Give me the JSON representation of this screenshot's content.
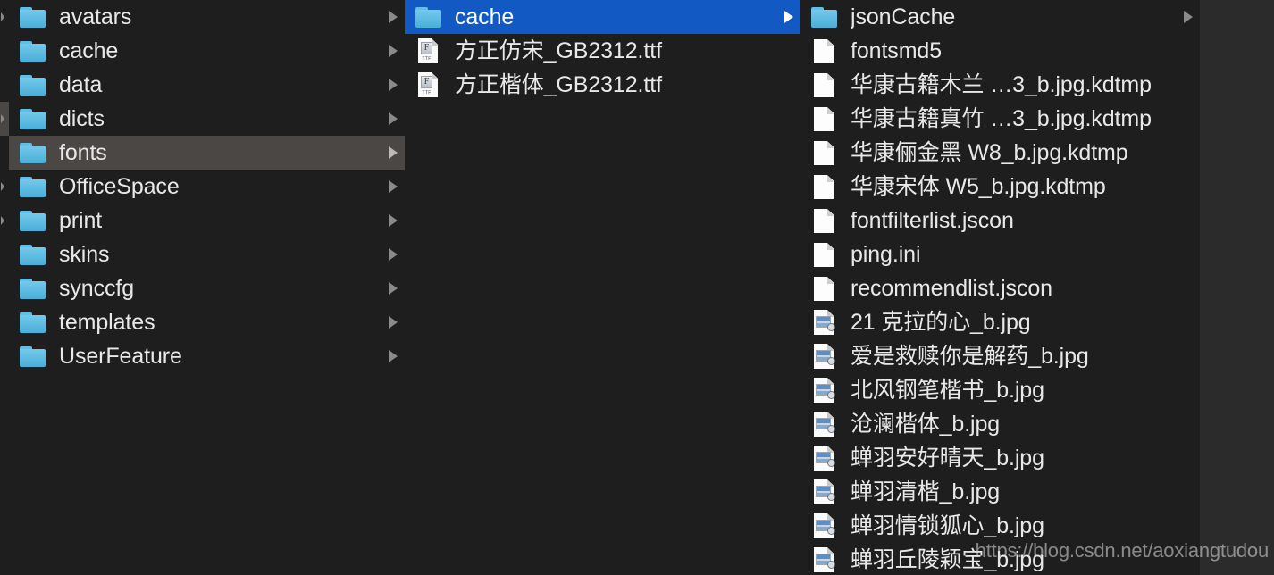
{
  "window": {
    "view_mode": "column-view",
    "background_color": "#2b2b2b",
    "column_background_color": "#1e1e1e",
    "selection_color": "#1259c4",
    "highlight_color": "#4a4745",
    "text_color": "#e8e8e8"
  },
  "partial_column": {
    "rows": [
      {
        "has_arrow": true,
        "highlighted": false
      },
      {
        "has_arrow": false,
        "highlighted": false
      },
      {
        "has_arrow": false,
        "highlighted": false
      },
      {
        "has_arrow": true,
        "highlighted": true
      },
      {
        "has_arrow": false,
        "highlighted": false
      },
      {
        "has_arrow": true,
        "highlighted": false
      },
      {
        "has_arrow": true,
        "highlighted": false
      },
      {
        "has_arrow": false,
        "highlighted": false
      },
      {
        "has_arrow": false,
        "highlighted": false
      },
      {
        "has_arrow": false,
        "highlighted": false
      },
      {
        "has_arrow": false,
        "highlighted": false
      },
      {
        "has_arrow": false,
        "highlighted": false
      },
      {
        "has_arrow": false,
        "highlighted": false
      },
      {
        "has_arrow": false,
        "highlighted": false
      },
      {
        "has_arrow": false,
        "highlighted": false
      },
      {
        "has_arrow": false,
        "highlighted": false
      },
      {
        "has_arrow": false,
        "highlighted": false
      }
    ]
  },
  "column_1": {
    "name": "parent-folder-column",
    "items": [
      {
        "label": "avatars",
        "icon": "folder-icon",
        "arrow": true,
        "state": "normal"
      },
      {
        "label": "cache",
        "icon": "folder-icon",
        "arrow": true,
        "state": "normal"
      },
      {
        "label": "data",
        "icon": "folder-icon",
        "arrow": true,
        "state": "normal"
      },
      {
        "label": "dicts",
        "icon": "folder-icon",
        "arrow": true,
        "state": "normal"
      },
      {
        "label": "fonts",
        "icon": "folder-icon",
        "arrow": true,
        "state": "highlighted"
      },
      {
        "label": "OfficeSpace",
        "icon": "folder-icon",
        "arrow": true,
        "state": "normal"
      },
      {
        "label": "print",
        "icon": "folder-icon",
        "arrow": true,
        "state": "normal"
      },
      {
        "label": "skins",
        "icon": "folder-icon",
        "arrow": true,
        "state": "normal"
      },
      {
        "label": "synccfg",
        "icon": "folder-icon",
        "arrow": true,
        "state": "normal"
      },
      {
        "label": "templates",
        "icon": "folder-icon",
        "arrow": true,
        "state": "normal"
      },
      {
        "label": "UserFeature",
        "icon": "folder-icon",
        "arrow": true,
        "state": "normal"
      }
    ]
  },
  "column_2": {
    "name": "fonts-folder-column",
    "items": [
      {
        "label": "cache",
        "icon": "folder-icon",
        "arrow": true,
        "state": "selected"
      },
      {
        "label": "方正仿宋_GB2312.ttf",
        "icon": "ttf-file-icon",
        "arrow": false,
        "state": "normal"
      },
      {
        "label": "方正楷体_GB2312.ttf",
        "icon": "ttf-file-icon",
        "arrow": false,
        "state": "normal"
      }
    ]
  },
  "column_3": {
    "name": "cache-folder-column",
    "items": [
      {
        "label": "jsonCache",
        "icon": "folder-icon",
        "arrow": true,
        "state": "normal"
      },
      {
        "label": "fontsmd5",
        "icon": "document-icon",
        "arrow": false,
        "state": "normal"
      },
      {
        "label": "华康古籍木兰 …3_b.jpg.kdtmp",
        "icon": "document-icon",
        "arrow": false,
        "state": "normal"
      },
      {
        "label": "华康古籍真竹 …3_b.jpg.kdtmp",
        "icon": "document-icon",
        "arrow": false,
        "state": "normal"
      },
      {
        "label": "华康俪金黑 W8_b.jpg.kdtmp",
        "icon": "document-icon",
        "arrow": false,
        "state": "normal"
      },
      {
        "label": "华康宋体 W5_b.jpg.kdtmp",
        "icon": "document-icon",
        "arrow": false,
        "state": "normal"
      },
      {
        "label": "fontfilterlist.jscon",
        "icon": "document-icon",
        "arrow": false,
        "state": "normal"
      },
      {
        "label": "ping.ini",
        "icon": "document-icon",
        "arrow": false,
        "state": "normal"
      },
      {
        "label": "recommendlist.jscon",
        "icon": "document-icon",
        "arrow": false,
        "state": "normal"
      },
      {
        "label": "21 克拉的心_b.jpg",
        "icon": "jpg-file-icon",
        "arrow": false,
        "state": "normal"
      },
      {
        "label": "爱是救赎你是解药_b.jpg",
        "icon": "jpg-file-icon",
        "arrow": false,
        "state": "normal"
      },
      {
        "label": "北风钢笔楷书_b.jpg",
        "icon": "jpg-file-icon",
        "arrow": false,
        "state": "normal"
      },
      {
        "label": "沧澜楷体_b.jpg",
        "icon": "jpg-file-icon",
        "arrow": false,
        "state": "normal"
      },
      {
        "label": "蝉羽安好晴天_b.jpg",
        "icon": "jpg-file-icon",
        "arrow": false,
        "state": "normal"
      },
      {
        "label": "蝉羽清楷_b.jpg",
        "icon": "jpg-file-icon",
        "arrow": false,
        "state": "normal"
      },
      {
        "label": "蝉羽情锁狐心_b.jpg",
        "icon": "jpg-file-icon",
        "arrow": false,
        "state": "normal"
      },
      {
        "label": "蝉羽丘陵颖宝_b.jpg",
        "icon": "jpg-file-icon",
        "arrow": false,
        "state": "normal"
      }
    ]
  },
  "watermark": {
    "text": "https://blog.csdn.net/aoxiangtudou"
  },
  "icon_glyphs": {
    "ttf_preview_letter": "F",
    "ttf_tag": "TTF"
  }
}
